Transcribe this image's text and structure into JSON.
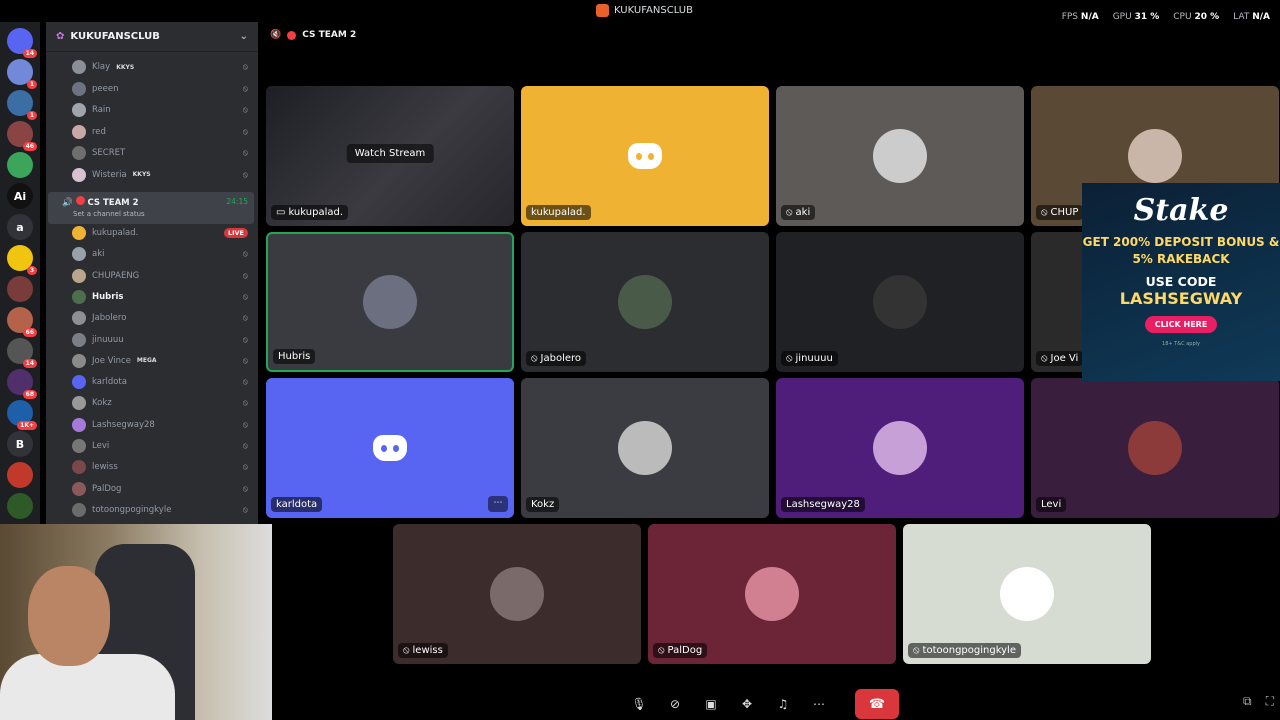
{
  "window": {
    "title": "KUKUFANSCLUB"
  },
  "perf": {
    "fps_label": "FPS",
    "fps": "N/A",
    "gpu_label": "GPU",
    "gpu": "31 %",
    "cpu_label": "CPU",
    "cpu": "20 %",
    "lat_label": "LAT",
    "lat": "N/A"
  },
  "servers": [
    {
      "badge": "14",
      "color": "#5865f2"
    },
    {
      "badge": "1",
      "color": "#7289da"
    },
    {
      "badge": "1",
      "color": "#3a6ea5"
    },
    {
      "badge": "46",
      "color": "#8b4444"
    },
    {
      "badge": "",
      "color": "#3ba55c"
    },
    {
      "badge": "",
      "color": "#111",
      "letter": "Ai"
    },
    {
      "badge": "",
      "color": "#313338",
      "letter": "a"
    },
    {
      "badge": "3",
      "color": "#f1c40f"
    },
    {
      "badge": "",
      "color": "#7a3b3b"
    },
    {
      "badge": "66",
      "color": "#b5624a"
    },
    {
      "badge": "14",
      "color": "#555"
    },
    {
      "badge": "68",
      "color": "#502f6b"
    },
    {
      "badge": "1K+",
      "color": "#1d5fa8"
    },
    {
      "badge": "",
      "color": "#313338",
      "letter": "B"
    },
    {
      "badge": "",
      "color": "#c0392b"
    },
    {
      "badge": "",
      "color": "#2d5a27"
    }
  ],
  "sidebar": {
    "server_name": "KUKUFANSCLUB",
    "channel": "CS TEAM 2",
    "channel_status": "Set a channel status",
    "timer": "24:15",
    "top_members": [
      {
        "name": "Klay",
        "tag": "KKYS"
      },
      {
        "name": "peeen",
        "tag": ""
      },
      {
        "name": "Rain",
        "tag": ""
      },
      {
        "name": "red",
        "tag": ""
      },
      {
        "name": "SECRET",
        "tag": ""
      },
      {
        "name": "Wisteria",
        "tag": "KKYS"
      }
    ],
    "voice_members": [
      {
        "name": "kukupalad.",
        "live": "LIVE"
      },
      {
        "name": "aki"
      },
      {
        "name": "CHUPAENG"
      },
      {
        "name": "Hubris"
      },
      {
        "name": "Jabolero"
      },
      {
        "name": "jinuuuu"
      },
      {
        "name": "Joe Vince",
        "tag": "MEGA"
      },
      {
        "name": "karldota"
      },
      {
        "name": "Kokz"
      },
      {
        "name": "Lashsegway28"
      },
      {
        "name": "Levi"
      },
      {
        "name": "lewiss"
      },
      {
        "name": "PalDog"
      },
      {
        "name": "totoongpogingkyle"
      }
    ]
  },
  "stage": {
    "channel": "CS TEAM 2",
    "watch_stream": "Watch Stream",
    "tiles": [
      {
        "name": "kukupalad.",
        "bg": "#2f3136"
      },
      {
        "name": "kukupalad.",
        "bg": "#f0b232"
      },
      {
        "name": "aki",
        "bg": "#5d5a58"
      },
      {
        "name": "CHUP",
        "bg": "#5a4a35"
      },
      {
        "name": "Hubris",
        "bg": "#3a3b40"
      },
      {
        "name": "Jabolero",
        "bg": "#2b2d31"
      },
      {
        "name": "jinuuuu",
        "bg": "#202124"
      },
      {
        "name": "Joe Vi",
        "bg": "#2a2a2a"
      },
      {
        "name": "karldota",
        "bg": "#5865f2"
      },
      {
        "name": "Kokz",
        "bg": "#3a3c42"
      },
      {
        "name": "Lashsegway28",
        "bg": "#4f1d7a"
      },
      {
        "name": "Levi",
        "bg": "#3a1e3e"
      },
      {
        "name": "lewiss",
        "bg": "#3d2c2c"
      },
      {
        "name": "PalDog",
        "bg": "#6b2536"
      },
      {
        "name": "totoongpogingkyle",
        "bg": "#d6dcd2"
      }
    ]
  },
  "ad": {
    "brand": "Stake",
    "line1": "GET 200% DEPOSIT BONUS & 5% RAKEBACK",
    "line2": "USE CODE",
    "code": "LASHSEGWAY",
    "cta": "CLICK HERE",
    "fine": "18+ T&C apply"
  }
}
